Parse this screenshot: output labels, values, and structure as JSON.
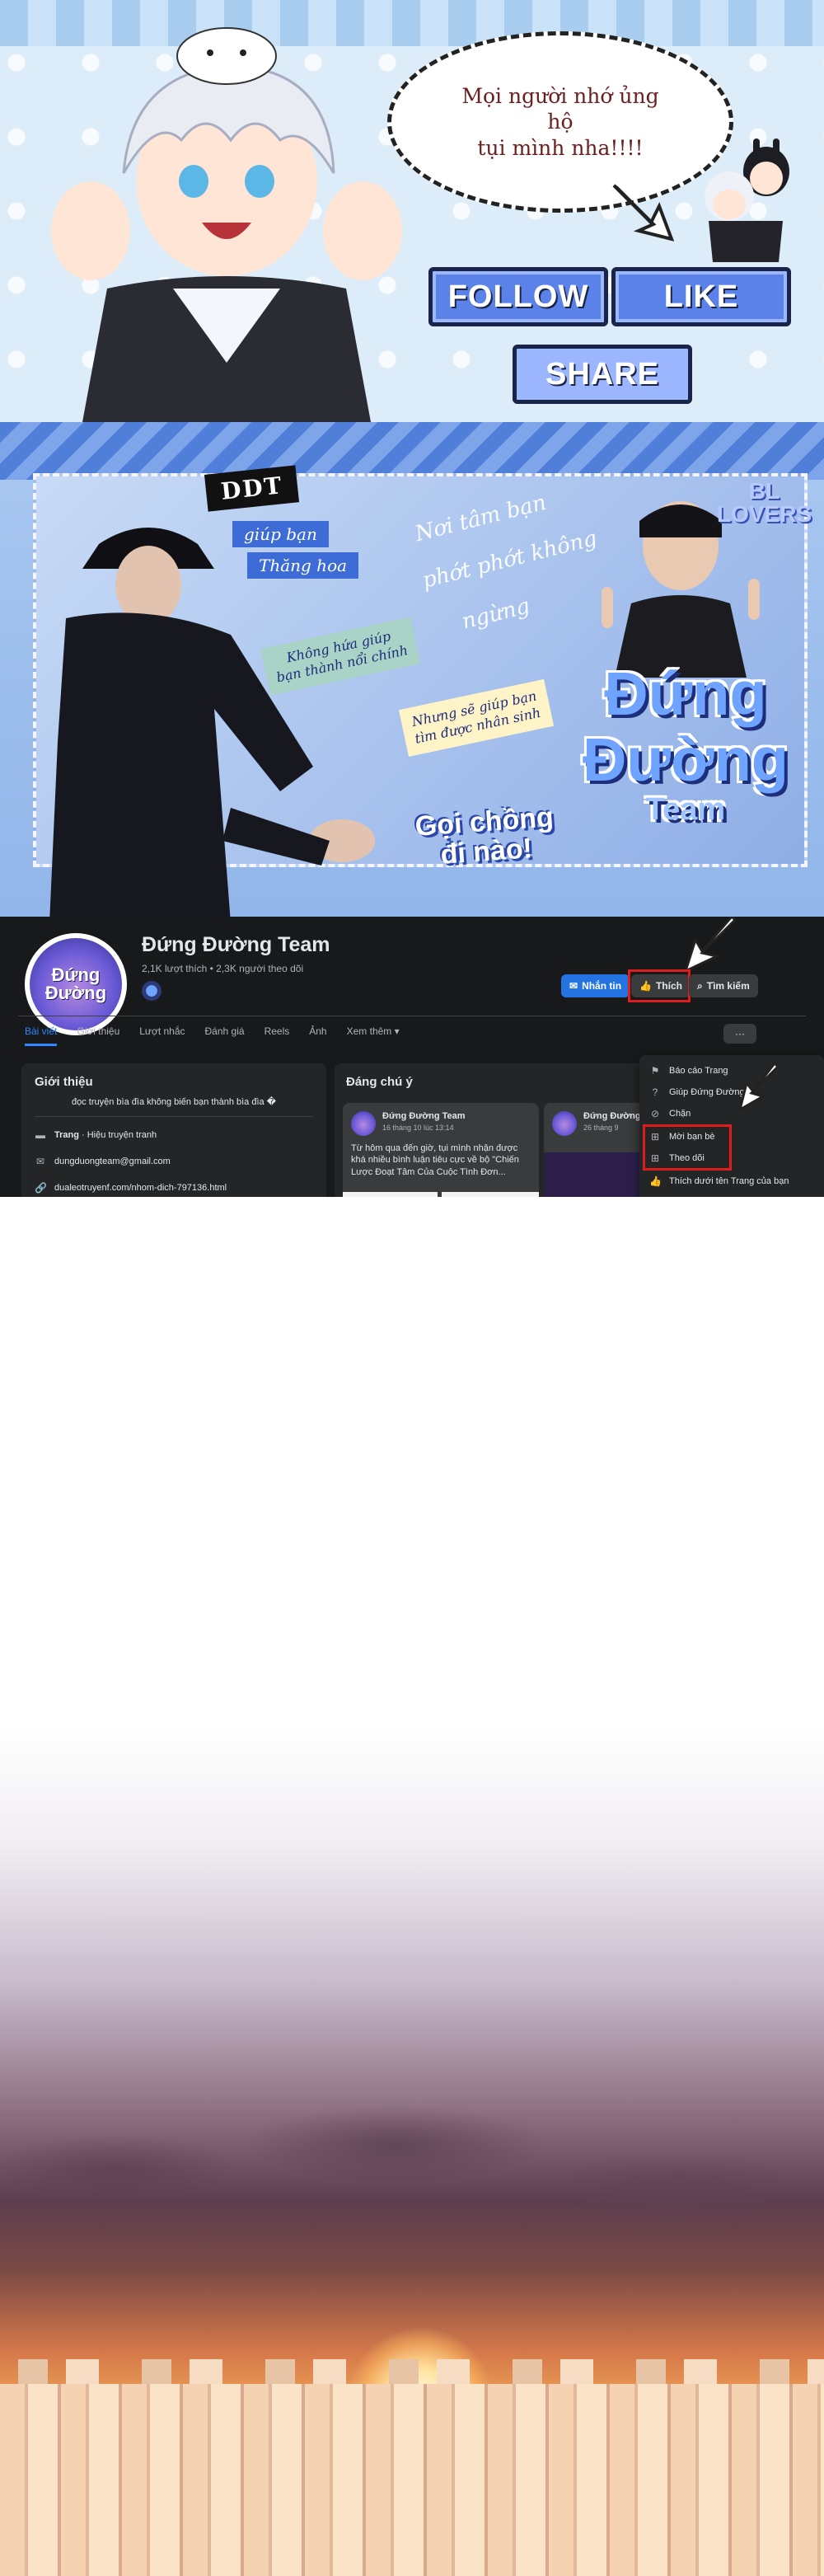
{
  "banner1": {
    "bubble_text": "Mọi người nhớ ủng hộ\ntụi mình nha!!!!",
    "follow_label": "FOLLOW",
    "like_label": "LIKE",
    "share_label": "SHARE"
  },
  "banner2": {
    "badge": "DDT",
    "tag1": "giúp bạn",
    "tag2": "Thăng hoa",
    "script1": "Nơi tâm bạn",
    "script2": "phớt phớt không",
    "script3": "ngừng",
    "note_green": "Không hứa giúp\nbạn thành nổi chính",
    "note_yellow": "Nhưng sẽ giúp bạn\ntìm được nhân sinh",
    "call_text": "Gọi chồng\nđi nào!",
    "bl_lovers": "BL\nLOVERS",
    "logo_line1": "Đứng",
    "logo_line2": "Đường",
    "logo_line3": "Team"
  },
  "fb": {
    "avatar_text_1": "Đứng",
    "avatar_text_2": "Đường",
    "page_name": "Đứng Đường Team",
    "page_stats": "2,1K lượt thích • 2,3K người theo dõi",
    "message_label": "Nhắn tin",
    "like_label": "Thích",
    "search_label": "Tìm kiếm",
    "more_label": "···",
    "tabs": [
      "Bài viết",
      "Giới thiệu",
      "Lượt nhắc",
      "Đánh giá",
      "Reels",
      "Ảnh",
      "Xem thêm ▾"
    ],
    "intro": {
      "title": "Giới thiệu",
      "description": "đọc truyện bìa đìa không biến bạn thành bìa đìa �",
      "category_prefix": "Trang",
      "category": " · Hiệu truyện tranh",
      "email": "dungduongteam@gmail.com",
      "link": "dualeotruyenf.com/nhom-dich-797136.html"
    },
    "featured": {
      "title": "Đáng chú ý",
      "post1": {
        "name": "Đứng Đường Team",
        "date": "16 tháng 10 lúc 13:14",
        "text": "Từ hôm qua đến giờ, tụi mình nhận được khá nhiều bình luận tiêu cực về bộ \"Chiến Lược Đoạt Tâm Của Cuộc Tình Đơn..."
      },
      "post2": {
        "name": "Đứng Đường",
        "date": "26 tháng 9"
      }
    },
    "dropdown": {
      "item1": "Báo cáo Trang",
      "item2": "Giúp Đứng Đường",
      "item3": "Chặn",
      "item4": "Mời bạn bè",
      "item5": "Theo dõi",
      "item6": "Thích dưới tên Trang của bạn"
    }
  },
  "colors": {
    "accent": "#2374e1",
    "highlight": "#e01d1d",
    "fb_dark": "#18191a"
  }
}
